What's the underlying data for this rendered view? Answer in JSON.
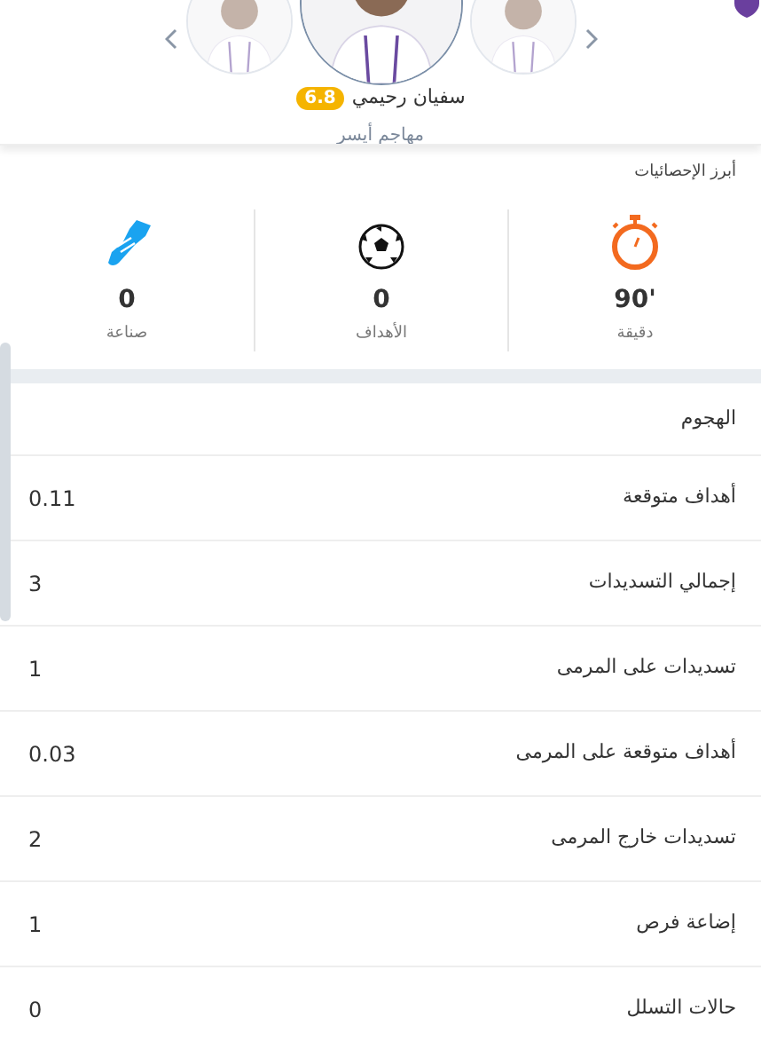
{
  "player": {
    "name": "سفيان رحيمي",
    "rating": "6.8",
    "position": "مهاجم أيسر"
  },
  "section_title": "أبرز الإحصائيات",
  "highlights": [
    {
      "kind": "minutes",
      "value": "'90",
      "label": "دقيقة"
    },
    {
      "kind": "goals",
      "value": "0",
      "label": "الأهداف"
    },
    {
      "kind": "assists",
      "value": "0",
      "label": "صناعة"
    }
  ],
  "stats_group": {
    "title": "الهجوم",
    "rows": [
      {
        "label": "أهداف متوقعة",
        "value": "0.11"
      },
      {
        "label": "إجمالي التسديدات",
        "value": "3"
      },
      {
        "label": "تسديدات على المرمى",
        "value": "1"
      },
      {
        "label": "أهداف متوقعة على المرمى",
        "value": "0.03"
      },
      {
        "label": "تسديدات خارج المرمى",
        "value": "2"
      },
      {
        "label": "إضاعة فرص",
        "value": "1"
      },
      {
        "label": "حالات التسلل",
        "value": "0"
      }
    ]
  }
}
